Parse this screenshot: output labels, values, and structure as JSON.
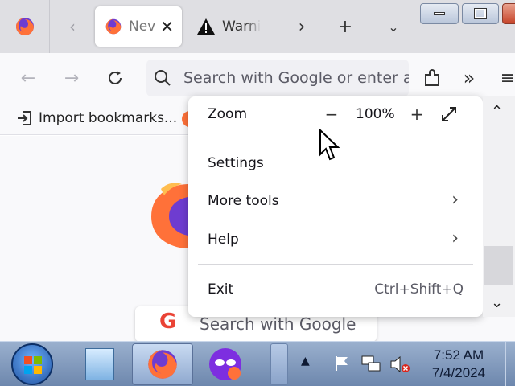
{
  "tabs": [
    {
      "label": "New Tab",
      "visible_label": "Nev",
      "icon": "firefox-icon",
      "active": true
    },
    {
      "label": "Warning",
      "visible_label": "Warni",
      "icon": "warning-icon",
      "active": false
    }
  ],
  "tabstrip": {
    "scroll_left_icon": "chevron-left-icon",
    "scroll_right_icon": "chevron-right-icon",
    "new_tab_icon": "plus-icon",
    "list_tabs_icon": "chevron-down-icon"
  },
  "navbar": {
    "url_placeholder": "Search with Google or enter a",
    "back_icon": "arrow-left-icon",
    "forward_icon": "arrow-right-icon",
    "reload_icon": "reload-icon"
  },
  "bookmarks": {
    "import_label": "Import bookmarks..."
  },
  "menu": {
    "zoom_label": "Zoom",
    "zoom_value": "100%",
    "settings_label": "Settings",
    "more_tools_label": "More tools",
    "help_label": "Help",
    "exit_label": "Exit",
    "exit_shortcut": "Ctrl+Shift+Q"
  },
  "content": {
    "search_placeholder": "Search with Google"
  },
  "taskbar": {
    "time": "7:52 AM",
    "date": "7/4/2024"
  },
  "colors": {
    "firefox_orange": "#ff7139",
    "firefox_purple": "#6e3cd0",
    "taskbar_blue": "#7d97bd",
    "menu_bg": "#ffffff"
  }
}
